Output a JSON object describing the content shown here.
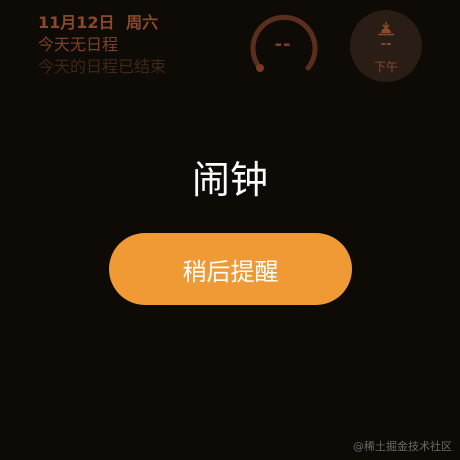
{
  "schedule": {
    "date": "11月12日",
    "weekday": "周六",
    "no_schedule_text": "今天无日程",
    "ended_text": "今天的日程已结束"
  },
  "gauge": {
    "value": "--",
    "icon": "arc-gauge-icon",
    "color": "#5a2e1c"
  },
  "sunset": {
    "icon": "sunset-icon",
    "value": "--",
    "label": "下午"
  },
  "alarm": {
    "title": "闹钟",
    "snooze_label": "稍后提醒"
  },
  "watermark": {
    "text": "@稀土掘金技术社区"
  },
  "colors": {
    "background": "#0e0b06",
    "accent": "#f09a35",
    "widget_text": "#8a4a2a"
  }
}
